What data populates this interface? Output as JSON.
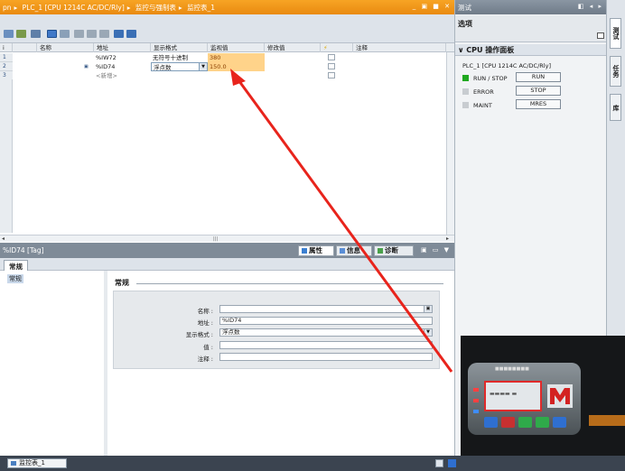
{
  "editor": {
    "breadcrumb": [
      "pn",
      "PLC_1 [CPU 1214C AC/DC/Rly]",
      "监控与强制表",
      "监控表_1"
    ],
    "window_controls": "_ ▣ ■ ✕"
  },
  "table": {
    "columns": [
      "i",
      "名称",
      "地址",
      "显示格式",
      "监视值",
      "修改值",
      "⚡",
      "注释"
    ],
    "rows": [
      {
        "num": "1",
        "name": "",
        "address": "%IW72",
        "format": "无符号十进制",
        "monitor": "380",
        "modify": "",
        "comment": ""
      },
      {
        "num": "2",
        "name": "",
        "address": "%ID74",
        "format": "浮点数",
        "monitor": "150.0",
        "modify": "",
        "comment": ""
      },
      {
        "num": "3",
        "name": "",
        "address": "<新增>",
        "format": "",
        "monitor": "",
        "modify": "",
        "comment": ""
      }
    ],
    "scroll_thumb": "|||"
  },
  "properties": {
    "title": "%ID74 [Tag]",
    "tabs": [
      "属性",
      "信息",
      "诊断"
    ],
    "sub_tab": "常规",
    "tree_item": "常规",
    "section": "常规",
    "fields": [
      {
        "label": "名称 :",
        "value": ""
      },
      {
        "label": "地址 :",
        "value": "%ID74"
      },
      {
        "label": "显示格式 :",
        "value": "浮点数"
      },
      {
        "label": "值 :",
        "value": ""
      },
      {
        "label": "注释 :",
        "value": ""
      }
    ]
  },
  "taskbar": {
    "tab_label": "监控表_1"
  },
  "right_panel": {
    "title": "测试",
    "options_label": "选项",
    "section_title": "CPU 操作面板",
    "plc_name": "PLC_1 [CPU 1214C AC/DC/Rly]",
    "status": [
      {
        "label": "RUN / STOP",
        "color": "#1fa81f",
        "button": "RUN"
      },
      {
        "label": "ERROR",
        "color": "#c8ccd0",
        "button": "STOP"
      },
      {
        "label": "MAINT",
        "color": "#c8ccd0",
        "button": "MRES"
      }
    ],
    "side_tabs": [
      "测试",
      "任务",
      "库"
    ]
  },
  "colors": {
    "title_orange": "#f39a1c",
    "monitor_cell": "#ffd38a",
    "arrow": "#e8241c"
  }
}
